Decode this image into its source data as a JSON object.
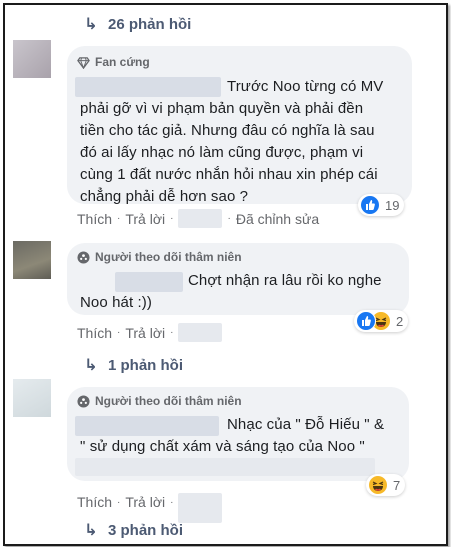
{
  "top_replies": {
    "label": "26 phản hồi"
  },
  "comments": [
    {
      "badge": "Fan cứng",
      "text": "Trước Noo từng có MV phải gỡ vì vi phạm bản quyền và phải đền tiền cho tác giả. Nhưng đâu có nghĩa là sau đó ai lấy nhạc nó làm cũng được, phạm vi cùng 1 đất nước nhắn hỏi nhau xin phép cái chẳng phải dễ hơn sao ?",
      "lines": [
        "Trước Noo từng có MV",
        "phải gỡ vì vi phạm bản quyền và phải đền",
        "tiền cho tác giả. Nhưng đâu có nghĩa là sau",
        "đó ai lấy nhạc nó làm cũng được, phạm vi",
        "cùng 1 đất nước nhắn hỏi nhau xin phép cái",
        "chẳng phải dễ hơn sao ?"
      ],
      "like": "Thích",
      "reply": "Trả lời",
      "edited": "Đã chỉnh sửa",
      "reaction_count": "19",
      "reactions": [
        "like-icon"
      ]
    },
    {
      "badge": "Người theo dõi thâm niên",
      "lines": [
        "Chợt nhận ra lâu rồi ko nghe",
        "Noo hát :))"
      ],
      "like": "Thích",
      "reply": "Trả lời",
      "reaction_count": "2",
      "reactions": [
        "like-icon",
        "haha-icon"
      ]
    },
    {
      "badge": "Người theo dõi thâm niên",
      "lines": [
        "Nhạc của \" Đỗ Hiếu \" &",
        "\" sử dụng chất xám và sáng tạo của Noo \""
      ],
      "like": "Thích",
      "reply": "Trả lời",
      "reaction_count": "7",
      "reactions": [
        "haha-icon"
      ]
    }
  ],
  "comment2_replies": {
    "label": "1 phản hồi"
  },
  "comment3_replies": {
    "label": "3 phản hồi"
  },
  "colors": {
    "bubble": "#f0f2f5",
    "text": "#1c1e21",
    "meta": "#65676b",
    "reply_link": "#4c5a73",
    "like_blue": "#1877f2",
    "haha_yellow": "#f7b928"
  }
}
